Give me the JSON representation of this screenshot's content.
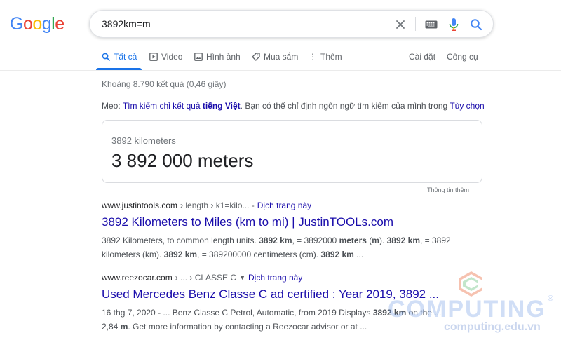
{
  "logo": {
    "text": "Google",
    "letters": [
      "G",
      "o",
      "o",
      "g",
      "l",
      "e"
    ],
    "colors": [
      "#4285f4",
      "#ea4335",
      "#fbbc05",
      "#4285f4",
      "#34a853",
      "#ea4335"
    ]
  },
  "search": {
    "query": "3892km=m",
    "icons": [
      "close-icon",
      "keyboard-icon",
      "mic-icon",
      "search-icon"
    ]
  },
  "tabs": {
    "all": "Tất cả",
    "video": "Video",
    "images": "Hình ảnh",
    "shopping": "Mua sắm",
    "more": "Thêm",
    "settings": "Cài đặt",
    "tools": "Công cụ"
  },
  "result_stats": "Khoảng 8.790 kết quả (0,46 giây)",
  "tip": {
    "prefix": "Mẹo:",
    "link1": "Tìm kiếm chỉ kết quả",
    "link_bold": "tiếng Việt",
    "middle": ". Bạn có thể chỉ định ngôn ngữ tìm kiếm của mình trong",
    "link2": "Tùy chọn"
  },
  "converter": {
    "from": "3892 kilometers =",
    "to": "3 892 000 meters",
    "more_info": "Thông tin thêm"
  },
  "results": [
    {
      "url": "www.justintools.com",
      "breadcrumb": "› length › k1=kilo... -",
      "translate": "Dịch trang này",
      "title": "3892 Kilometers to Miles (km to mi) | JustinTOOLs.com",
      "snippet": {
        "s1": "3892 Kilometers, to common length units. ",
        "b1": "3892 km",
        "s2": ", = 3892000 ",
        "b2": "meters",
        "s3": " (",
        "b3": "m",
        "s4": "). ",
        "b4": "3892 km",
        "s5": ", = 3892 kilometers (km). ",
        "b5": "3892 km",
        "s6": ", = 389200000 centimeters (cm). ",
        "b6": "3892 km",
        "s7": " ..."
      }
    },
    {
      "url": "www.reezocar.com",
      "breadcrumb": "› ... › CLASSE C",
      "translate": "Dịch trang này",
      "title": "Used Mercedes Benz Classe C ad certified : Year 2019, 3892 ...",
      "snippet": {
        "s1": "16 thg 7, 2020 - ... Benz Classe C Petrol, Automatic, from 2019 Displays ",
        "b1": "3892 km",
        "s2": " on the ... 2,84 ",
        "b2": "m",
        "s3": ". Get more information by contacting a Reezocar advisor or at ..."
      }
    }
  ],
  "watermark": {
    "word": "COMPUTING",
    "domain": "computing.edu.vn",
    "reg": "®"
  }
}
